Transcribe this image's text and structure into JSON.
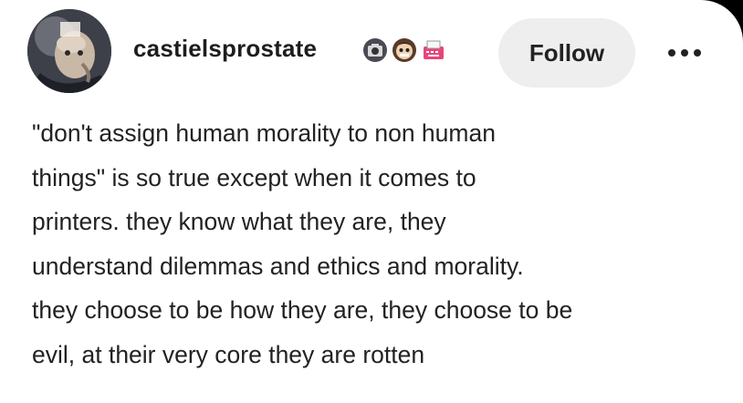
{
  "post": {
    "username": "castielsprostate",
    "follow_label": "Follow",
    "body": "\"don't assign human morality to non human\nthings\" is so true except when it comes to\nprinters. they know what they are, they\nunderstand dilemmas and ethics and morality.\nthey choose to be how they are, they choose to be\nevil, at their very core they are rotten"
  },
  "icons": {
    "avatar": "avatar-image",
    "badges": [
      "camera-badge-icon",
      "face-badge-icon",
      "typewriter-badge-icon"
    ],
    "more": "more-options-icon"
  },
  "colors": {
    "background": "#ffffff",
    "text": "#222222",
    "follow_button_bg": "#eeeeee",
    "frame": "#000000"
  }
}
